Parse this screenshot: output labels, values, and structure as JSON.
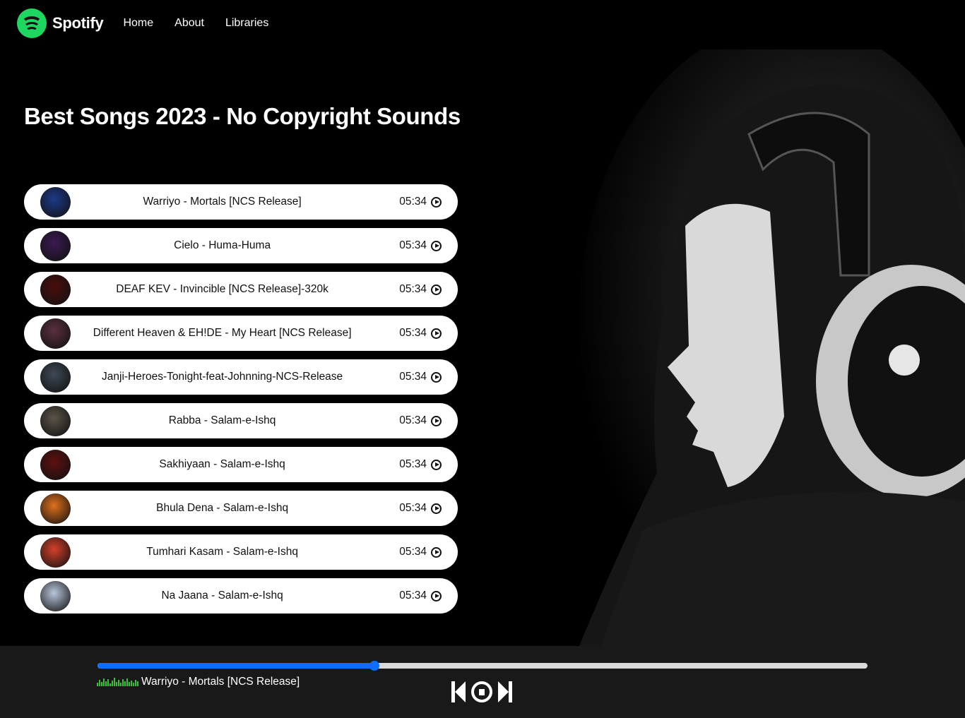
{
  "nav": {
    "brand": "Spotify",
    "links": [
      "Home",
      "About",
      "Libraries"
    ]
  },
  "playlist": {
    "title": "Best Songs 2023 - No Copyright Sounds",
    "songs": [
      {
        "name": "Warriyo - Mortals [NCS Release]",
        "time": "05:34",
        "cover": "#1d3a8a"
      },
      {
        "name": "Cielo - Huma-Huma",
        "time": "05:34",
        "cover": "#3b1a52"
      },
      {
        "name": "DEAF KEV - Invincible [NCS Release]-320k",
        "time": "05:34",
        "cover": "#4a0d0d"
      },
      {
        "name": "Different Heaven & EH!DE - My Heart [NCS Release]",
        "time": "05:34",
        "cover": "#5a2f3f"
      },
      {
        "name": "Janji-Heroes-Tonight-feat-Johnning-NCS-Release",
        "time": "05:34",
        "cover": "#3e4955"
      },
      {
        "name": "Rabba - Salam-e-Ishq",
        "time": "05:34",
        "cover": "#5b5448"
      },
      {
        "name": "Sakhiyaan - Salam-e-Ishq",
        "time": "05:34",
        "cover": "#5e1010"
      },
      {
        "name": "Bhula Dena - Salam-e-Ishq",
        "time": "05:34",
        "cover": "#e0701c"
      },
      {
        "name": "Tumhari Kasam - Salam-e-Ishq",
        "time": "05:34",
        "cover": "#d4402a"
      },
      {
        "name": "Na Jaana - Salam-e-Ishq",
        "time": "05:34",
        "cover": "#b9c6dc"
      }
    ]
  },
  "player": {
    "now_playing": "Warriyo - Mortals [NCS Release]",
    "progress": 0.36,
    "accent_color": "#0d6efd",
    "icons": [
      "equalizer-icon",
      "previous-icon",
      "pause-icon",
      "next-icon"
    ]
  }
}
